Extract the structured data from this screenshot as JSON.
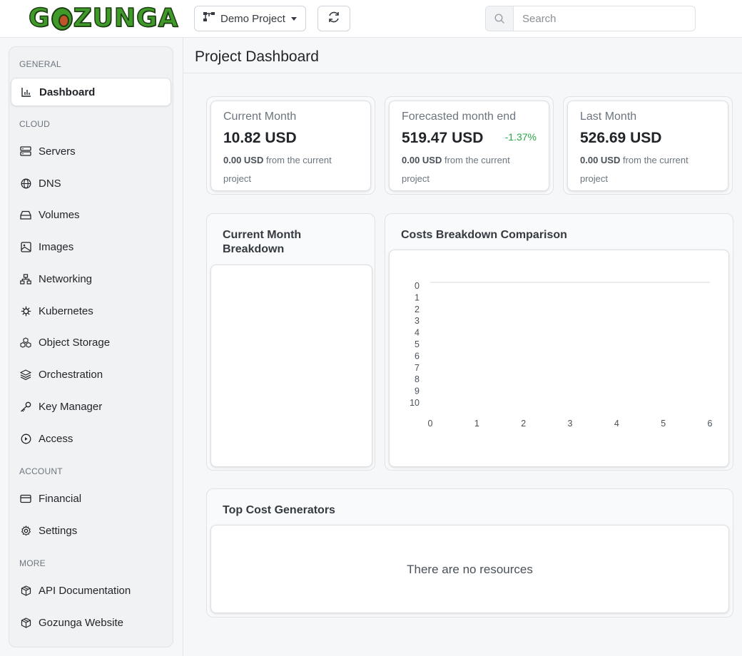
{
  "brand": {
    "logo_text": "GOZUNGA"
  },
  "topbar": {
    "project_label": "Demo Project",
    "search_placeholder": "Search"
  },
  "sidebar": {
    "sections": [
      {
        "title": "GENERAL",
        "items": [
          {
            "label": "Dashboard",
            "icon": "bar-chart-icon",
            "active": true
          }
        ]
      },
      {
        "title": "CLOUD",
        "items": [
          {
            "label": "Servers",
            "icon": "server-icon"
          },
          {
            "label": "DNS",
            "icon": "globe-icon"
          },
          {
            "label": "Volumes",
            "icon": "hard-drive-icon"
          },
          {
            "label": "Images",
            "icon": "image-icon"
          },
          {
            "label": "Networking",
            "icon": "network-icon"
          },
          {
            "label": "Kubernetes",
            "icon": "helm-icon"
          },
          {
            "label": "Object Storage",
            "icon": "boxes-icon"
          },
          {
            "label": "Orchestration",
            "icon": "layers-icon"
          },
          {
            "label": "Key Manager",
            "icon": "key-icon"
          },
          {
            "label": "Access",
            "icon": "circle-play-icon"
          }
        ]
      },
      {
        "title": "ACCOUNT",
        "items": [
          {
            "label": "Financial",
            "icon": "credit-card-icon"
          },
          {
            "label": "Settings",
            "icon": "gear-icon"
          }
        ]
      },
      {
        "title": "MORE",
        "items": [
          {
            "label": "API Documentation",
            "icon": "package-icon"
          },
          {
            "label": "Gozunga Website",
            "icon": "package-icon"
          }
        ]
      }
    ]
  },
  "page": {
    "title": "Project Dashboard"
  },
  "stats": [
    {
      "label": "Current Month",
      "value": "10.82 USD",
      "delta": "",
      "note_bold": "0.00 USD",
      "note_rest": " from the current project"
    },
    {
      "label": "Forecasted month end",
      "value": "519.47 USD",
      "delta": "-1.37%",
      "note_bold": "0.00 USD",
      "note_rest": " from the current project"
    },
    {
      "label": "Last Month",
      "value": "526.69 USD",
      "delta": "",
      "note_bold": "0.00 USD",
      "note_rest": " from the current project"
    }
  ],
  "breakdown": {
    "title": "Current Month Breakdown"
  },
  "comparison": {
    "title": "Costs Breakdown Comparison"
  },
  "top_cost": {
    "title": "Top Cost Generators",
    "empty_message": "There are no resources"
  },
  "chart_data": {
    "type": "line",
    "title": "Costs Breakdown Comparison",
    "x_ticks": [
      "0",
      "1",
      "2",
      "3",
      "4",
      "5",
      "6"
    ],
    "y_ticks": [
      "0",
      "1",
      "2",
      "3",
      "4",
      "5",
      "6",
      "7",
      "8",
      "9",
      "10"
    ],
    "xlim": [
      0,
      6
    ],
    "ylim": [
      0,
      10
    ],
    "y_inverted": true,
    "series": [],
    "grid": false,
    "colors": {
      "baseline": "#e6e6e6",
      "tick_text": "#495057"
    }
  },
  "colors": {
    "accent_positive": "#28a745",
    "brand_green": "#3f9a2a"
  }
}
